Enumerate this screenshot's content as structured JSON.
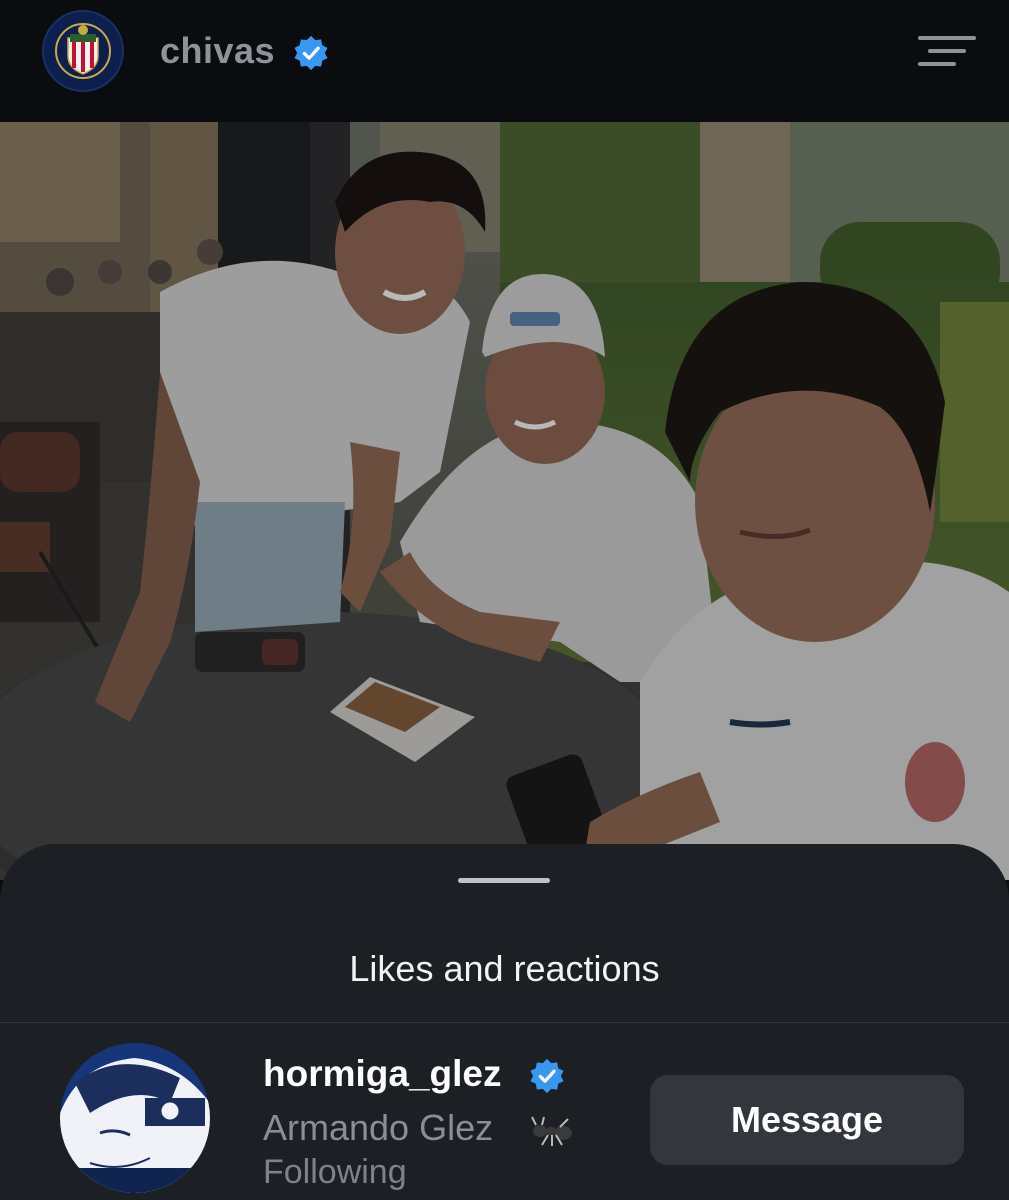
{
  "header": {
    "username": "chivas",
    "avatar_icon": "chivas-crest-icon",
    "verified_icon": "verified-badge-icon",
    "menu_icon": "hamburger-menu-icon"
  },
  "sheet": {
    "title": "Likes and reactions",
    "items": [
      {
        "username": "hormiga_glez",
        "display_name": "Armando Glez",
        "name_emoji_icon": "ant-emoji-icon",
        "status": "Following",
        "action_label": "Message"
      }
    ]
  },
  "colors": {
    "background": "#0b0d10",
    "sheet": "#1c1f24",
    "verified": "#3897f0",
    "button": "#33363c",
    "muted_text": "#8a8e95"
  }
}
